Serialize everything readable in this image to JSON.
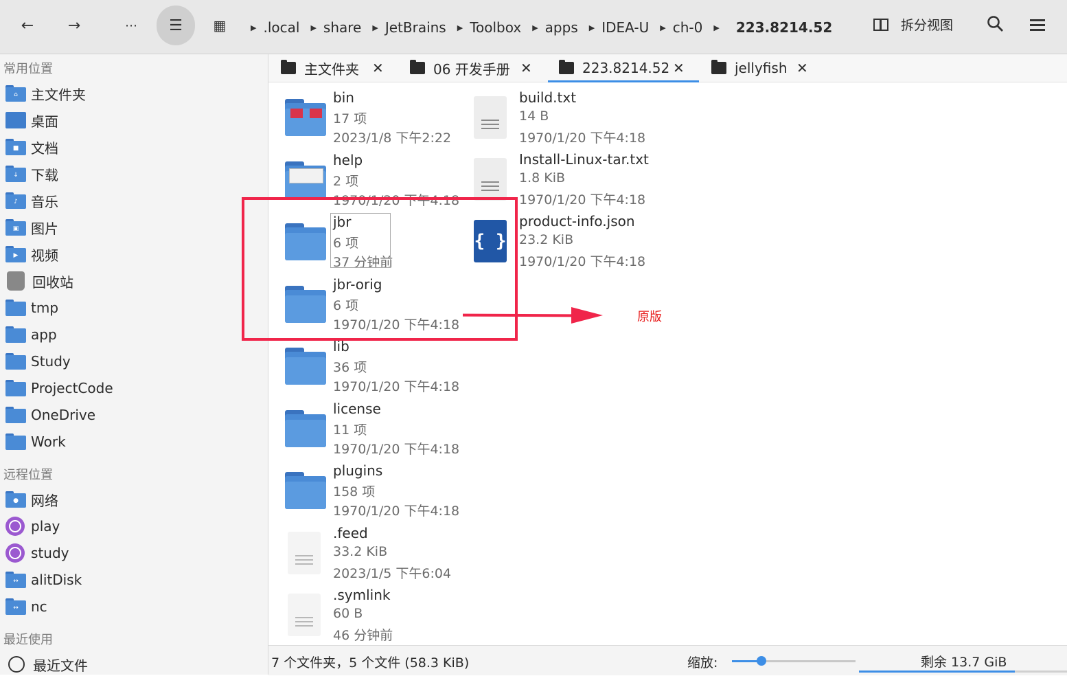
{
  "toolbar": {
    "breadcrumbs": [
      ".local",
      "share",
      "JetBrains",
      "Toolbox",
      "apps",
      "IDEA-U",
      "ch-0"
    ],
    "current": "223.8214.52",
    "split_view_label": "拆分视图"
  },
  "sidebar": {
    "section_common": "常用位置",
    "common": [
      {
        "label": "主文件夹",
        "icon": "home-folder-icon"
      },
      {
        "label": "桌面",
        "icon": "desktop-icon"
      },
      {
        "label": "文档",
        "icon": "documents-folder-icon"
      },
      {
        "label": "下载",
        "icon": "downloads-folder-icon"
      },
      {
        "label": "音乐",
        "icon": "music-folder-icon"
      },
      {
        "label": "图片",
        "icon": "pictures-folder-icon"
      },
      {
        "label": "视频",
        "icon": "videos-folder-icon"
      },
      {
        "label": "回收站",
        "icon": "trash-icon"
      },
      {
        "label": "tmp",
        "icon": "folder-icon"
      },
      {
        "label": "app",
        "icon": "folder-icon"
      },
      {
        "label": "Study",
        "icon": "folder-icon"
      },
      {
        "label": "ProjectCode",
        "icon": "folder-icon"
      },
      {
        "label": "OneDrive",
        "icon": "folder-icon"
      },
      {
        "label": "Work",
        "icon": "folder-icon"
      }
    ],
    "section_remote": "远程位置",
    "remote": [
      {
        "label": "网络",
        "icon": "network-folder-icon"
      },
      {
        "label": "play",
        "icon": "globe-icon"
      },
      {
        "label": "study",
        "icon": "globe-icon"
      },
      {
        "label": "alitDisk",
        "icon": "remote-folder-icon"
      },
      {
        "label": "nc",
        "icon": "remote-folder-icon"
      }
    ],
    "section_recent": "最近使用",
    "recent": [
      {
        "label": "最近文件",
        "icon": "clock-icon"
      }
    ]
  },
  "tabs": [
    {
      "label": "主文件夹",
      "active": false
    },
    {
      "label": "06 开发手册",
      "active": false
    },
    {
      "label": "223.8214.52",
      "active": true
    },
    {
      "label": "jellyfish",
      "active": false
    }
  ],
  "files": {
    "col1": [
      {
        "name": "bin",
        "count": "17 项",
        "date": "2023/1/8 下午2:22",
        "icon": "bin-folder-icon"
      },
      {
        "name": "help",
        "count": "2 项",
        "date": "1970/1/20 下午4:18",
        "icon": "help-folder-icon"
      },
      {
        "name": "jbr",
        "count": "6 项",
        "date": "37 分钟前",
        "icon": "folder-icon"
      },
      {
        "name": "jbr-orig",
        "count": "6 项",
        "date": "1970/1/20 下午4:18",
        "icon": "folder-icon"
      },
      {
        "name": "lib",
        "count": "36 项",
        "date": "1970/1/20 下午4:18",
        "icon": "folder-icon"
      },
      {
        "name": "license",
        "count": "11 项",
        "date": "1970/1/20 下午4:18",
        "icon": "folder-icon"
      },
      {
        "name": "plugins",
        "count": "158 项",
        "date": "1970/1/20 下午4:18",
        "icon": "folder-icon"
      },
      {
        "name": ".feed",
        "count": "33.2 KiB",
        "date": "2023/1/5 下午6:04",
        "icon": "hidden-file-icon"
      },
      {
        "name": ".symlink",
        "count": "60 B",
        "date": "46 分钟前",
        "icon": "hidden-file-icon"
      }
    ],
    "col2": [
      {
        "name": "build.txt",
        "count": "14 B",
        "date": "1970/1/20 下午4:18",
        "icon": "text-file-icon"
      },
      {
        "name": "Install-Linux-tar.txt",
        "count": "1.8 KiB",
        "date": "1970/1/20 下午4:18",
        "icon": "text-file-icon"
      },
      {
        "name": "product-info.json",
        "count": "23.2 KiB",
        "date": "1970/1/20 下午4:18",
        "icon": "json-file-icon"
      }
    ]
  },
  "annotation": {
    "label": "原版",
    "color": "#f0254a"
  },
  "statusbar": {
    "summary": "7 个文件夹，5 个文件 (58.3 KiB)",
    "zoom_label": "缩放:",
    "zoom_level": 0.24,
    "free_space": "剩余 13.7 GiB",
    "used_fraction": 0.75
  },
  "colors": {
    "accent": "#3d8ee6",
    "folder": "#4a8bd6"
  }
}
